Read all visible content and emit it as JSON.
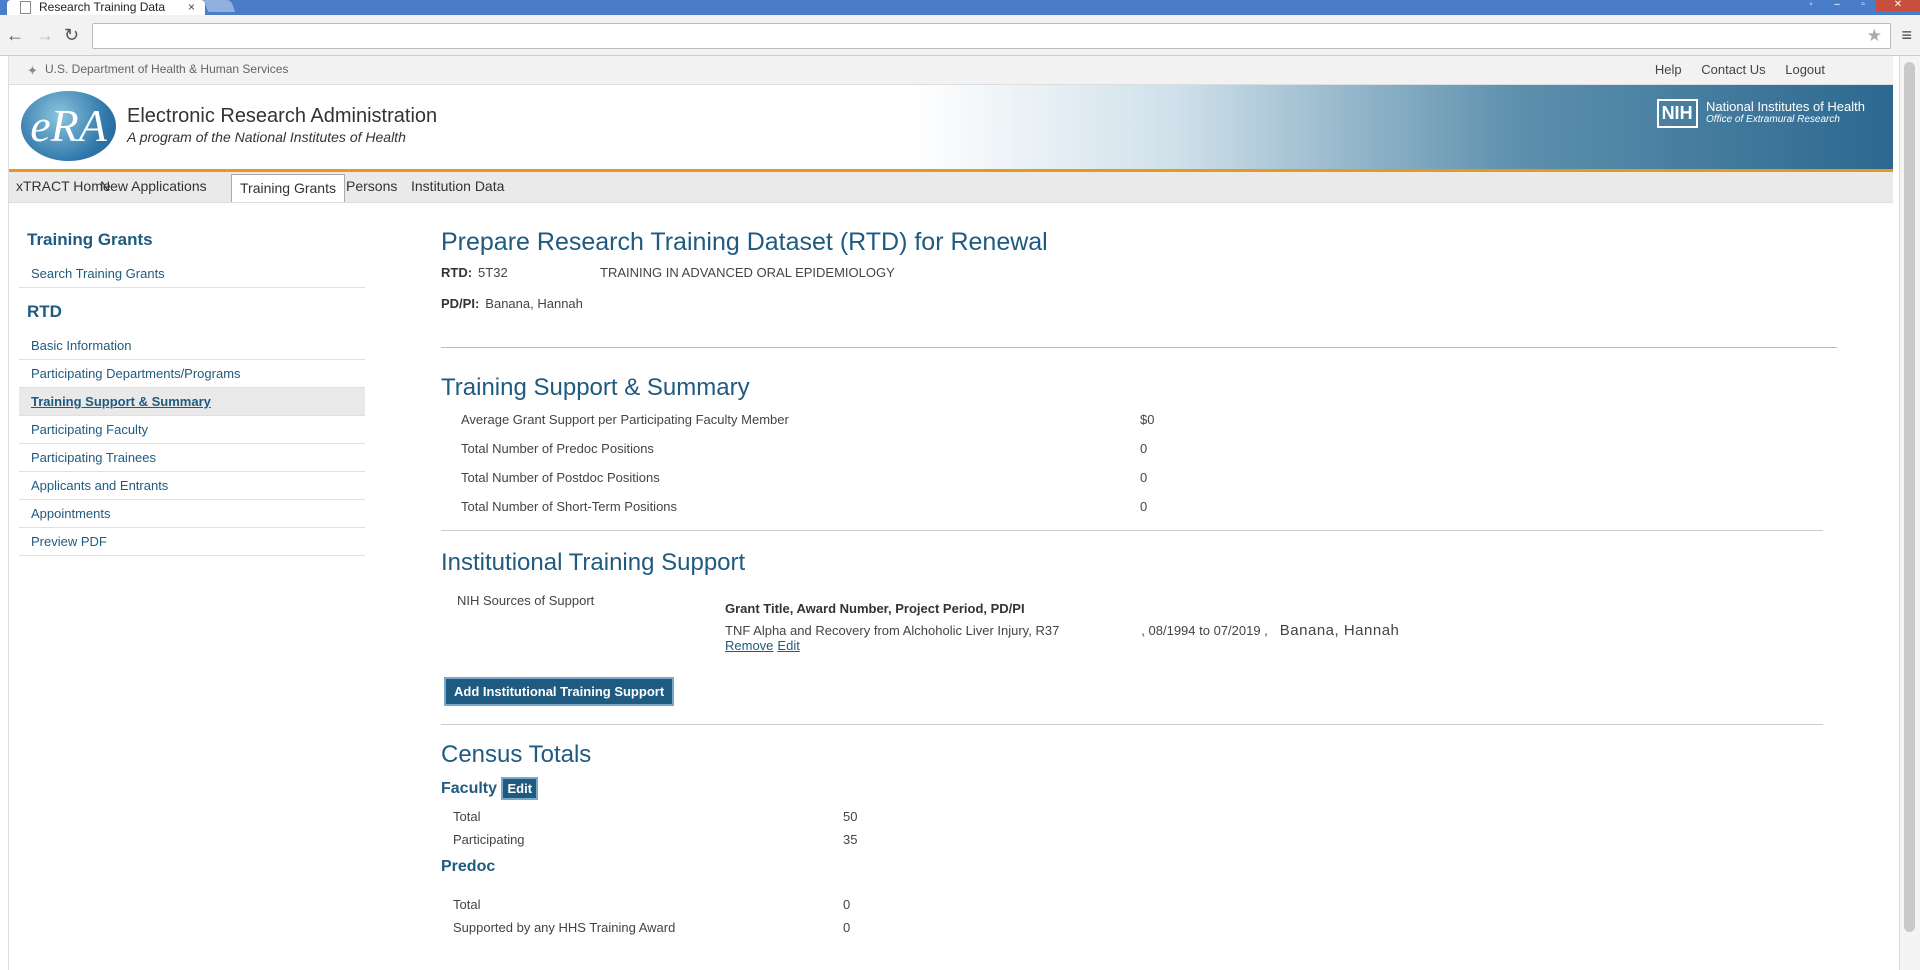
{
  "browser": {
    "tab_title": "Research Training Data",
    "tab_close": "×"
  },
  "agency": {
    "hhs_label": "U.S. Department of Health & Human Services"
  },
  "toplinks": [
    "Help",
    "Contact Us",
    "Logout"
  ],
  "banner": {
    "logo_text": "eRA",
    "title": "Electronic Research Administration",
    "subtitle": "A program of the National Institutes of Health",
    "nih_mark": "NIH",
    "nih_name": "National Institutes of Health",
    "nih_office": "Office of Extramural Research"
  },
  "nav": {
    "items": [
      "xTRACT Home",
      "New Applications",
      "Training Grants",
      "Persons",
      "Institution Data"
    ],
    "active": "Training Grants"
  },
  "sidebar": {
    "section1_title": "Training Grants",
    "section1_items": [
      "Search Training Grants"
    ],
    "section2_title": "RTD",
    "section2_items": [
      "Basic Information",
      "Participating Departments/Programs",
      "Training Support & Summary",
      "Participating Faculty",
      "Participating Trainees",
      "Applicants and Entrants",
      "Appointments",
      "Preview PDF"
    ],
    "selected": "Training Support & Summary"
  },
  "main": {
    "title": "Prepare Research Training Dataset (RTD) for Renewal",
    "rtd_label": "RTD:",
    "rtd_number": "5T32",
    "rtd_title": "TRAINING IN ADVANCED ORAL EPIDEMIOLOGY",
    "pdpi_label": "PD/PI:",
    "pdpi_name": "Banana, Hannah"
  },
  "training_support": {
    "heading": "Training Support & Summary",
    "rows": [
      {
        "label": "Average Grant Support per Participating Faculty Member",
        "value": "$0"
      },
      {
        "label": "Total Number of Predoc Positions",
        "value": "0"
      },
      {
        "label": "Total Number of Postdoc Positions",
        "value": "0"
      },
      {
        "label": "Total Number of Short-Term Positions",
        "value": "0"
      }
    ]
  },
  "institutional": {
    "heading": "Institutional Training Support",
    "source_label": "NIH Sources of Support",
    "grant_header": "Grant Title, Award Number, Project Period, PD/PI",
    "grant_row": "TNF Alpha and Recovery from Alchoholic Liver Injury, R37",
    "grant_period": ", 08/1994 to 07/2019 ,",
    "grant_pi": "Banana, Hannah",
    "remove_label": "Remove",
    "edit_label": "Edit",
    "add_button": "Add Institutional Training Support"
  },
  "census": {
    "heading": "Census Totals",
    "faculty_heading": "Faculty",
    "faculty_edit": "Edit",
    "faculty_rows": [
      {
        "label": "Total",
        "value": "50"
      },
      {
        "label": "Participating",
        "value": "35"
      }
    ],
    "predoc_heading": "Predoc",
    "predoc_rows": [
      {
        "label": "Total",
        "value": "0"
      },
      {
        "label": "Supported by any HHS Training Award",
        "value": "0"
      }
    ]
  }
}
